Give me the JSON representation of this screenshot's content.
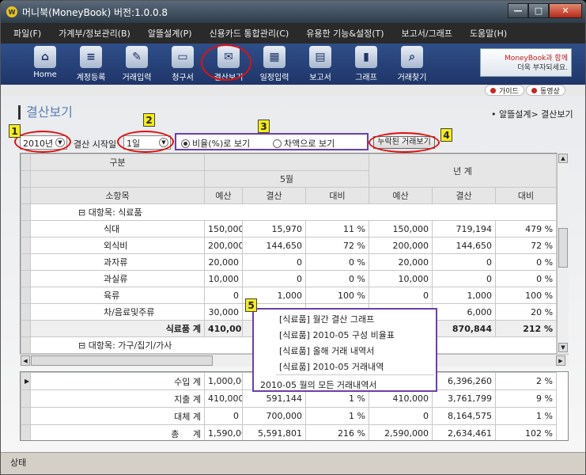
{
  "window": {
    "title": "머니북(MoneyBook) 버전:1.0.0.8",
    "app_icon": "W"
  },
  "menu": [
    "파일(F)",
    "가계부/정보관리(B)",
    "알뜰설계(P)",
    "신용카드 통합관리(C)",
    "유용한 기능&설정(T)",
    "보고서/그래프",
    "도움말(H)"
  ],
  "toolbar": [
    {
      "label": "Home",
      "icon": "home-icon",
      "glyph": "⌂"
    },
    {
      "label": "계정등록",
      "icon": "account-register-icon",
      "glyph": "≡"
    },
    {
      "label": "거래입력",
      "icon": "transaction-input-icon",
      "glyph": "✎"
    },
    {
      "label": "청구서",
      "icon": "card-bill-icon",
      "glyph": "▭"
    },
    {
      "label": "결산보기",
      "icon": "settlement-view-icon",
      "glyph": "✉"
    },
    {
      "label": "일정입력",
      "icon": "calendar-icon",
      "glyph": "▦"
    },
    {
      "label": "보고서",
      "icon": "report-icon",
      "glyph": "▤"
    },
    {
      "label": "그래프",
      "icon": "graph-icon",
      "glyph": "▮"
    },
    {
      "label": "거래찾기",
      "icon": "search-icon",
      "glyph": "⌕"
    }
  ],
  "ad": {
    "line1": "MoneyBook과 함께",
    "line2": "더욱 부자되세요."
  },
  "links": {
    "guide": "가이드",
    "video": "동영상"
  },
  "page": {
    "title": "결산보기",
    "breadcrumb": "• 알뜰설계> 결산보기"
  },
  "filters": {
    "year": "2010년",
    "start_label": "결산 시작일",
    "start_day": "1일",
    "radio_ratio": "비율(%)로 보기",
    "radio_diff": "차액으로 보기",
    "missing_btn": "누락된 거래보기"
  },
  "badges": [
    "1",
    "2",
    "3",
    "4",
    "5"
  ],
  "grid": {
    "h_group": "구분",
    "h_month": "5월",
    "h_year": "년 계",
    "h_sub": "소항목",
    "cols": [
      "예산",
      "결산",
      "대비",
      "예산",
      "결산",
      "대비"
    ],
    "cat1": "⊟ 대항목: 식료품",
    "rows": [
      {
        "name": "식대",
        "v": [
          "150,000",
          "15,970",
          "11 %",
          "150,000",
          "719,194",
          "479 %"
        ]
      },
      {
        "name": "외식비",
        "v": [
          "200,000",
          "144,650",
          "72 %",
          "200,000",
          "144,650",
          "72 %"
        ]
      },
      {
        "name": "과자류",
        "v": [
          "20,000",
          "0",
          "0 %",
          "20,000",
          "0",
          "0 %"
        ]
      },
      {
        "name": "과실류",
        "v": [
          "10,000",
          "0",
          "0 %",
          "10,000",
          "0",
          "0 %"
        ]
      },
      {
        "name": "육류",
        "v": [
          "0",
          "1,000",
          "100 %",
          "0",
          "1,000",
          "100 %"
        ]
      },
      {
        "name": "차/음료및주류",
        "v": [
          "30,000",
          "",
          "",
          "",
          "6,000",
          "20 %"
        ]
      }
    ],
    "total": {
      "name": "식료품 계",
      "v": [
        "410,000",
        "",
        "",
        "",
        "870,844",
        "212 %"
      ]
    },
    "cat2": "⊟ 대항목: 가구/집기/가사"
  },
  "summary": [
    {
      "name": "수입 계",
      "v": [
        "1,000,000",
        "",
        "",
        "",
        "6,396,260",
        "2 %"
      ]
    },
    {
      "name": "지출 계",
      "v": [
        "410,000",
        "591,144",
        "1 %",
        "410,000",
        "3,761,799",
        "9 %"
      ]
    },
    {
      "name": "대체 계",
      "v": [
        "0",
        "700,000",
        "1 %",
        "0",
        "8,164,575",
        "1 %"
      ]
    },
    {
      "name": "총     계",
      "v": [
        "1,590,000",
        "5,591,801",
        "216 %",
        "2,590,000",
        "2,634,461",
        "102 %"
      ]
    }
  ],
  "context_menu": [
    "[식료품] 월간 결산 그래프",
    "[식료품] 2010-05 구성 비율표",
    "[식료품] 올해 거래 내역서",
    "[식료품] 2010-05 거래내역",
    "2010-05 월의 모든 거래내역서"
  ],
  "status": "상태"
}
